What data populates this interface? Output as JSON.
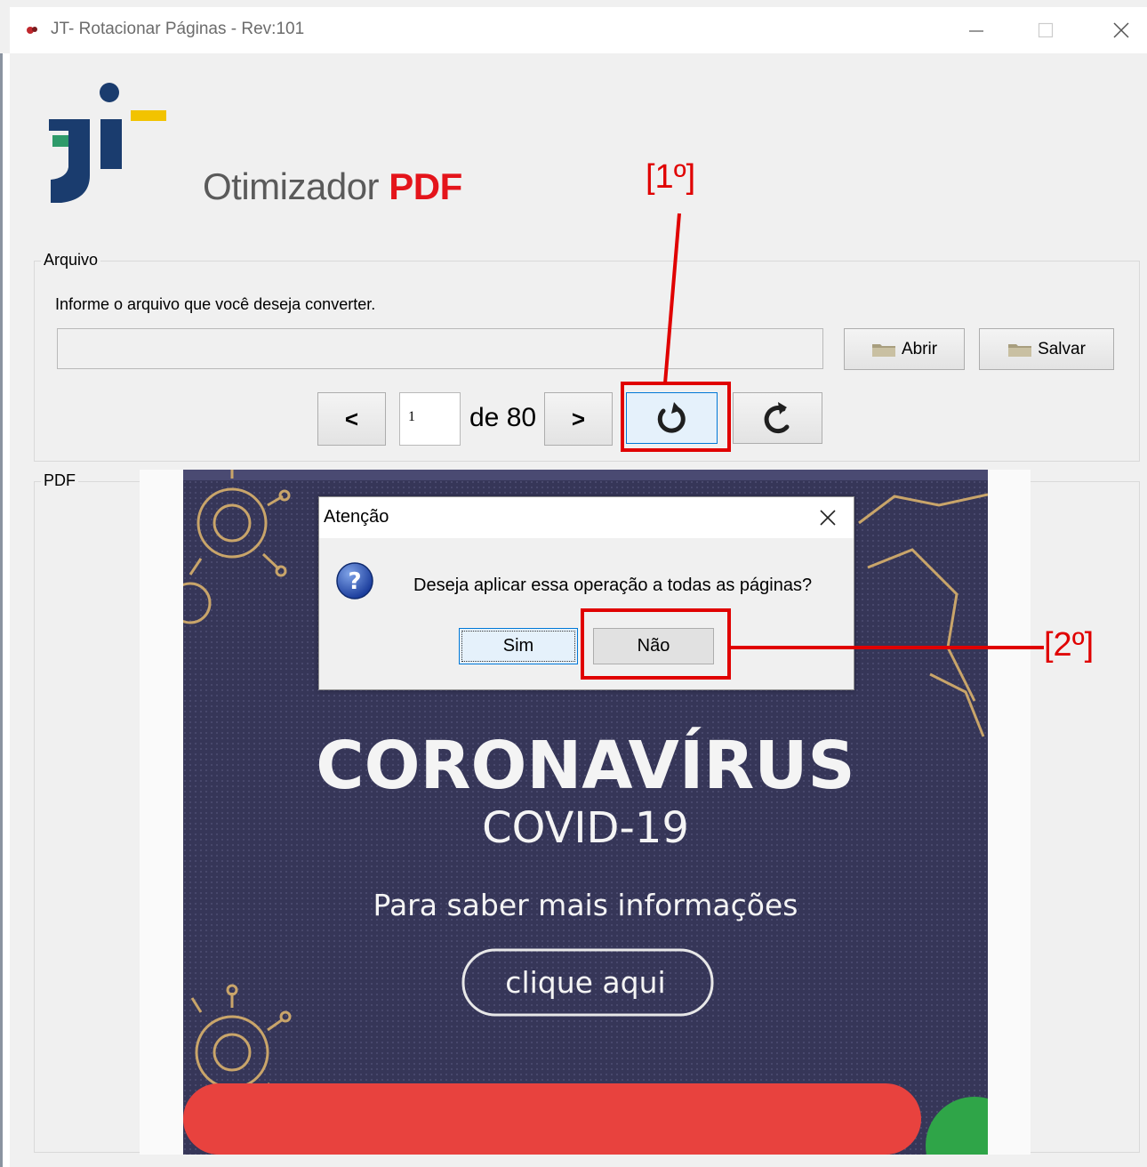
{
  "window": {
    "title": "JT- Rotacionar Páginas - Rev:101",
    "controls": [
      "minimize-icon",
      "maximize-icon",
      "close-icon"
    ]
  },
  "brand": {
    "name_prefix": "Otimizador",
    "name_suffix": "PDF",
    "accent_color": "#e4141b"
  },
  "file_group": {
    "label": "Arquivo",
    "hint": "Informe o arquivo que você deseja converter.",
    "path_value": "",
    "open_label": "Abrir",
    "save_label": "Salvar"
  },
  "navigation": {
    "prev_label": "<",
    "current_page": "1",
    "total_text": "de 80",
    "next_label": ">",
    "rotate_left_icon": "rotate-counterclockwise-icon",
    "rotate_right_icon": "rotate-clockwise-icon"
  },
  "pdf_group": {
    "label": "PDF",
    "page_content": {
      "headline": "CORONAVÍRUS",
      "subheadline": "COVID-19",
      "info": "Para saber mais informações",
      "cta": "clique aqui"
    }
  },
  "dialog": {
    "title": "Atenção",
    "message": "Deseja aplicar essa operação a todas as páginas?",
    "yes_label": "Sim",
    "no_label": "Não",
    "icon": "question-icon"
  },
  "annotations": {
    "step1": "[1º]",
    "step2": "[2º]",
    "color": "#e00000"
  }
}
